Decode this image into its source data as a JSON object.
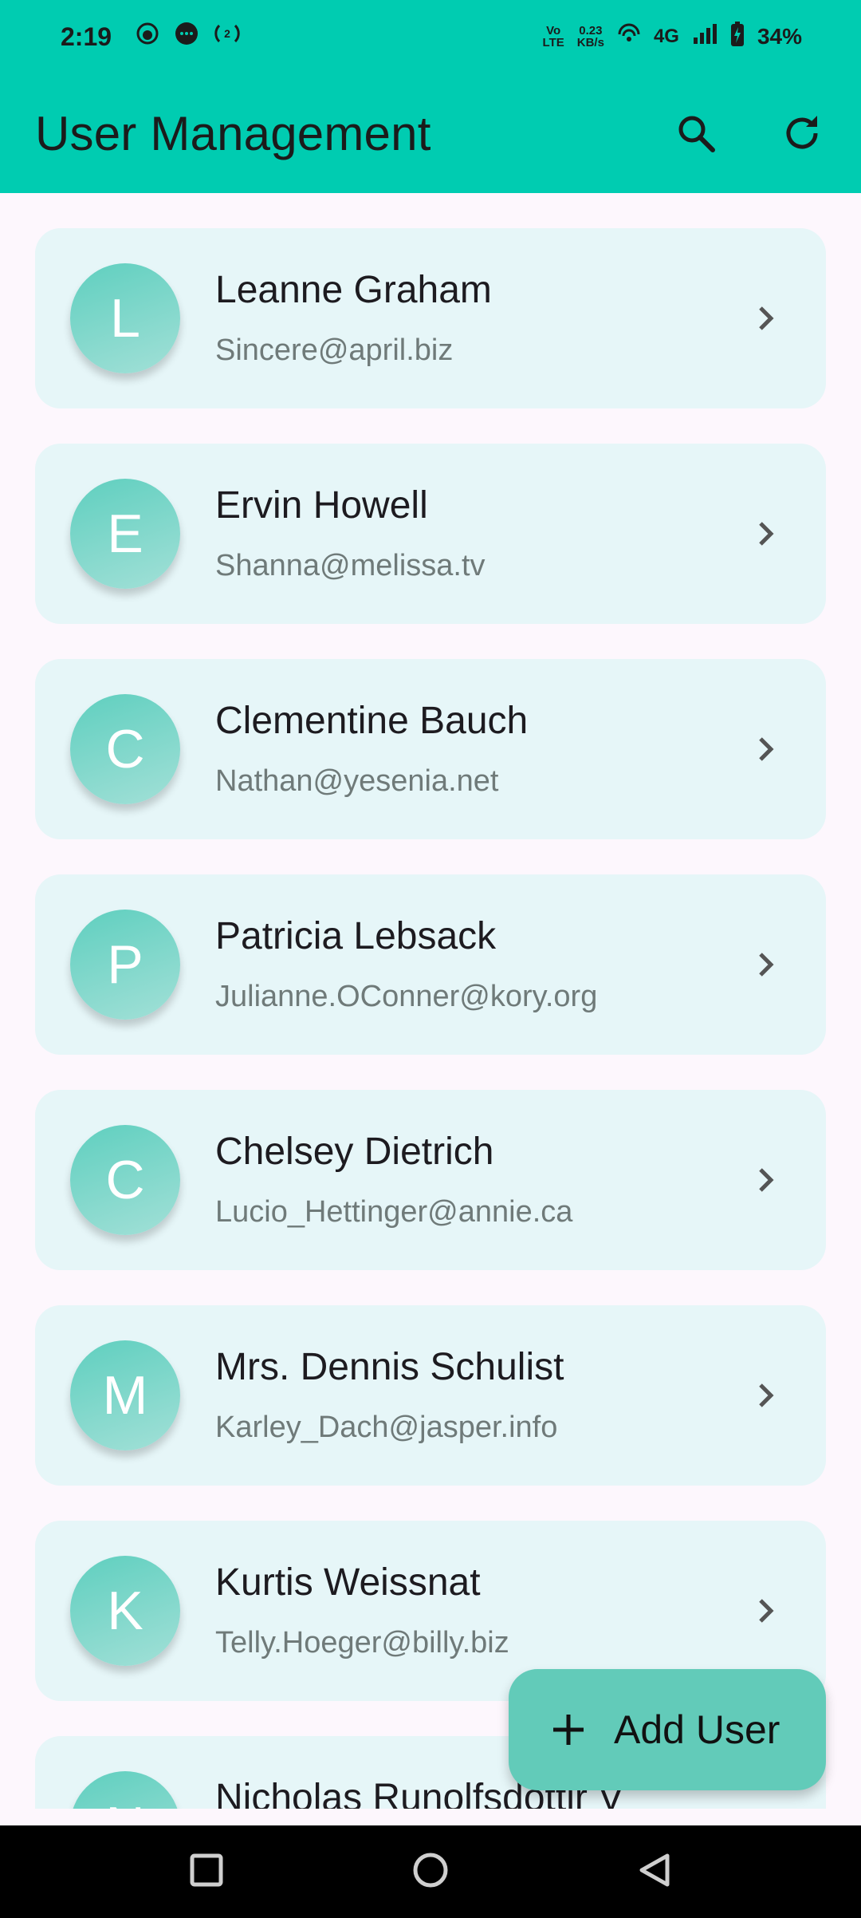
{
  "status_bar": {
    "time": "2:19",
    "net_type": "VoLTE",
    "speed_value": "0.23",
    "speed_unit": "KB/s",
    "network": "4G",
    "battery": "34%",
    "icons": [
      "face-icon",
      "message-icon",
      "hotspot-icon",
      "wifi-signal-icon",
      "cell-signal-icon",
      "battery-charging-icon"
    ]
  },
  "app_bar": {
    "title": "User Management",
    "actions": [
      "search-icon",
      "refresh-icon"
    ]
  },
  "users": [
    {
      "initial": "L",
      "name": "Leanne Graham",
      "email": "Sincere@april.biz"
    },
    {
      "initial": "E",
      "name": "Ervin Howell",
      "email": "Shanna@melissa.tv"
    },
    {
      "initial": "C",
      "name": "Clementine Bauch",
      "email": "Nathan@yesenia.net"
    },
    {
      "initial": "P",
      "name": "Patricia Lebsack",
      "email": "Julianne.OConner@kory.org"
    },
    {
      "initial": "C",
      "name": "Chelsey Dietrich",
      "email": "Lucio_Hettinger@annie.ca"
    },
    {
      "initial": "M",
      "name": "Mrs. Dennis Schulist",
      "email": "Karley_Dach@jasper.info"
    },
    {
      "initial": "K",
      "name": "Kurtis Weissnat",
      "email": "Telly.Hoeger@billy.biz"
    },
    {
      "initial": "N",
      "name": "Nicholas Runolfsdottir V",
      "email": ""
    }
  ],
  "fab": {
    "label": "Add User",
    "icon": "plus-icon"
  },
  "colors": {
    "app_bar": "#00ccb1",
    "card_bg": "#e6f6f8",
    "avatar": "#5fcfbf",
    "fab": "#62cbb9",
    "page_bg": "#fdf7fd"
  },
  "nav_bar": {
    "icons": [
      "recents-icon",
      "home-icon",
      "back-icon"
    ]
  }
}
